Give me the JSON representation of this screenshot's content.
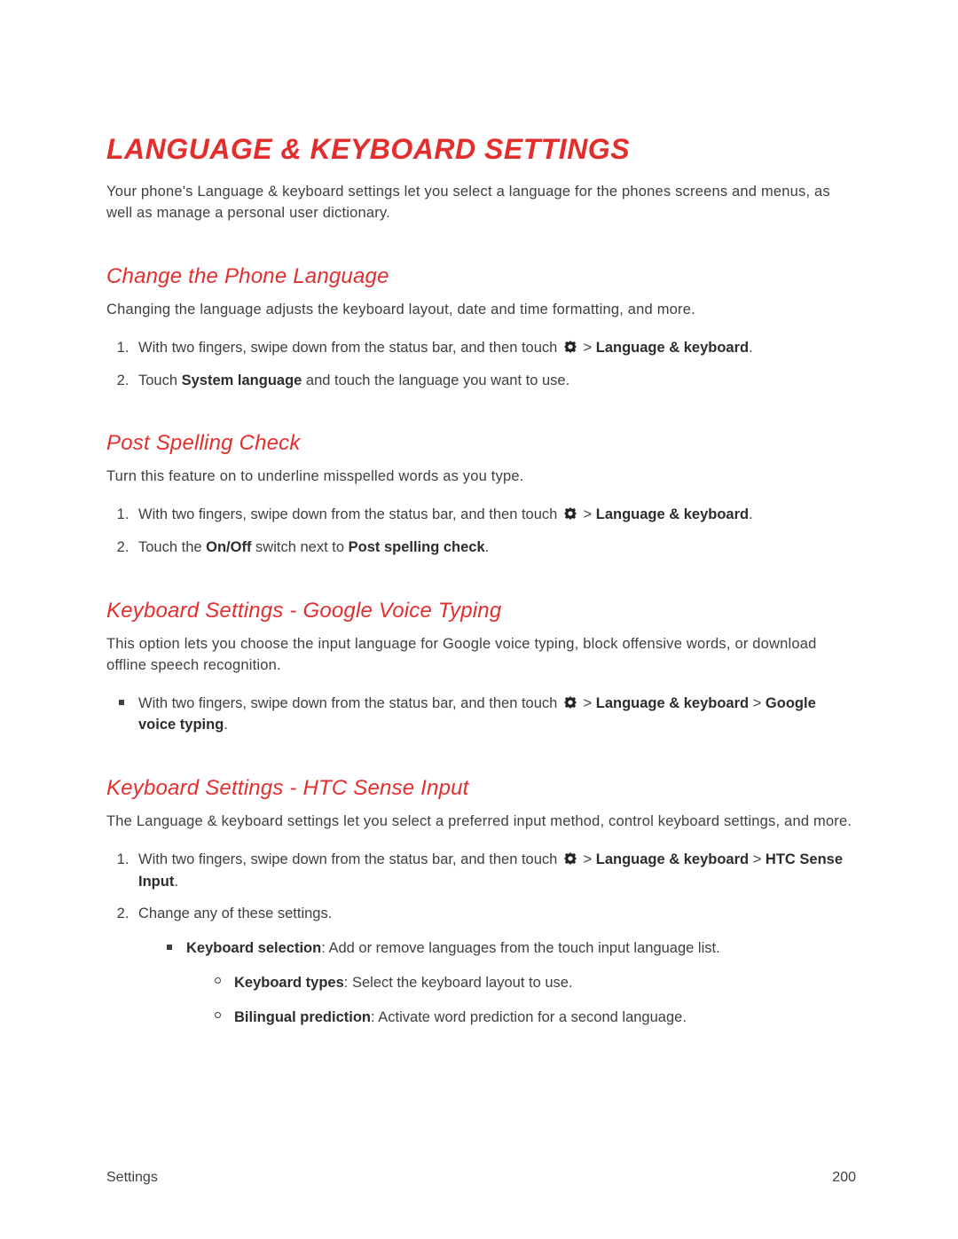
{
  "title": "LANGUAGE & KEYBOARD SETTINGS",
  "intro": "Your phone's Language & keyboard settings let you select a language for the phones screens and menus, as well as manage a personal user dictionary.",
  "sections": {
    "change_language": {
      "heading": "Change the Phone Language",
      "intro": "Changing the language adjusts the keyboard layout, date and time formatting, and more.",
      "steps": {
        "s1_pre": "With two fingers, swipe down from the status bar, and then touch ",
        "s1_gt": " > ",
        "s1_bold": "Language & keyboard",
        "s1_post": ".",
        "s2_pre": "Touch ",
        "s2_bold": "System language",
        "s2_post": " and touch the language you want to use."
      }
    },
    "post_spelling": {
      "heading": "Post Spelling Check",
      "intro": "Turn this feature on to underline misspelled words as you type.",
      "steps": {
        "s1_pre": "With two fingers, swipe down from the status bar, and then touch ",
        "s1_gt": " > ",
        "s1_bold": "Language & keyboard",
        "s1_post": ".",
        "s2_pre": "Touch the ",
        "s2_bold1": "On/Off",
        "s2_mid": " switch next to ",
        "s2_bold2": "Post spelling check",
        "s2_post": "."
      }
    },
    "google_voice": {
      "heading": "Keyboard Settings - Google Voice Typing",
      "intro": "This option lets you choose the input language for Google voice typing, block offensive words, or download offline speech recognition.",
      "bullet": {
        "pre": "With two fingers, swipe down from the status bar, and then touch ",
        "gt": " > ",
        "bold1": "Language & keyboard",
        "mid": " > ",
        "bold2": "Google voice typing",
        "post": "."
      }
    },
    "htc_sense": {
      "heading": "Keyboard Settings - HTC Sense Input",
      "intro": "The Language & keyboard settings let you select a preferred input method, control keyboard settings, and more.",
      "steps": {
        "s1_pre": "With two fingers, swipe down from the status bar, and then touch ",
        "s1_gt": " > ",
        "s1_bold1": "Language & keyboard",
        "s1_mid": " > ",
        "s1_bold2": "HTC Sense Input",
        "s1_post": ".",
        "s2": "Change any of these settings.",
        "sub1_bold": "Keyboard selection",
        "sub1_rest": ": Add or remove languages from the touch input language list.",
        "sub1a_bold": "Keyboard types",
        "sub1a_rest": ": Select the keyboard layout to use.",
        "sub1b_bold": "Bilingual prediction",
        "sub1b_rest": ": Activate word prediction for a second language."
      }
    }
  },
  "footer": {
    "left": "Settings",
    "right": "200"
  }
}
